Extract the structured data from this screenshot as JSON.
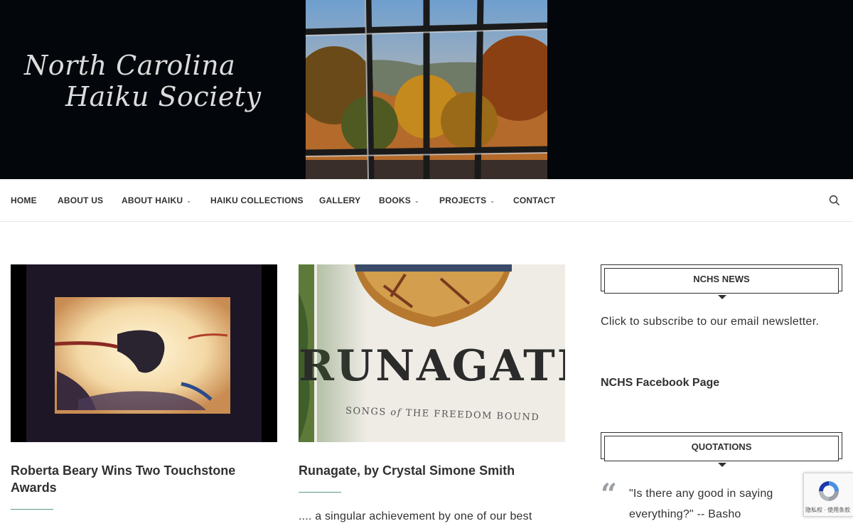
{
  "site": {
    "title_line1": "North Carolina",
    "title_line2": "Haiku Society"
  },
  "nav": {
    "items": [
      {
        "label": "HOME",
        "has_dropdown": false
      },
      {
        "label": "ABOUT US",
        "has_dropdown": false
      },
      {
        "label": "ABOUT HAIKU",
        "has_dropdown": true
      },
      {
        "label": "HAIKU COLLECTIONS",
        "has_dropdown": false
      },
      {
        "label": "GALLERY",
        "has_dropdown": false
      },
      {
        "label": "BOOKS",
        "has_dropdown": true
      },
      {
        "label": "PROJECTS",
        "has_dropdown": true
      },
      {
        "label": "CONTACT",
        "has_dropdown": false
      }
    ],
    "search_icon": "search-icon"
  },
  "posts": [
    {
      "title": "Roberta Beary Wins Two Touchstone Awards",
      "excerpt": ""
    },
    {
      "title": "Runagate, by Crystal Simone Smith",
      "excerpt": ".... a singular achievement by one of our best",
      "book_title": "RUNAGATE",
      "book_subtitle_a": "SONGS",
      "book_subtitle_of": "of",
      "book_subtitle_b": "THE FREEDOM BOUND"
    }
  ],
  "sidebar": {
    "news": {
      "heading": "NCHS NEWS",
      "text": "Click to subscribe to our email newsletter.",
      "facebook_link": "NCHS Facebook Page"
    },
    "quotations": {
      "heading": "QUOTATIONS",
      "quote_mark": "“",
      "quote": "\"Is there any good in saying everything?\" -- Basho"
    }
  },
  "recaptcha": {
    "terms": "隐私权 · 使用条款"
  },
  "colors": {
    "banner_bg": "#03070c",
    "text": "#313131",
    "accent_separator": "#5a9a8a"
  }
}
